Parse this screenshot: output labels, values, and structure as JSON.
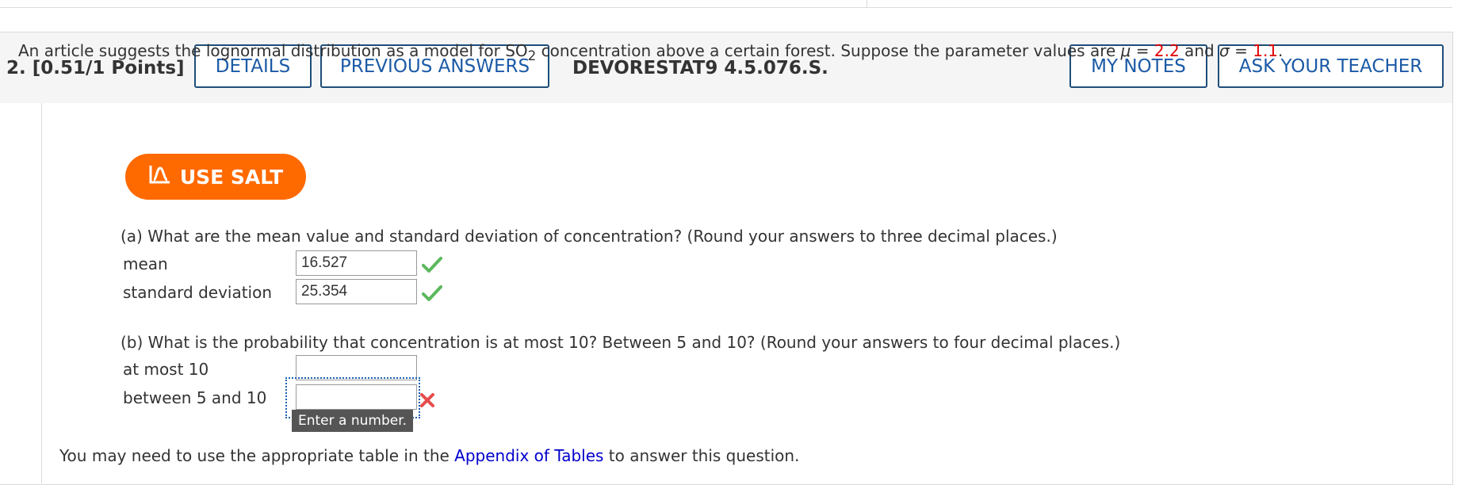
{
  "header": {
    "question_number": "2. [0.51/1 Points]",
    "details_label": "DETAILS",
    "previous_answers_label": "PREVIOUS ANSWERS",
    "problem_code": "DEVORESTAT9 4.5.076.S.",
    "my_notes_label": "MY NOTES",
    "ask_teacher_label": "ASK YOUR TEACHER"
  },
  "intro": {
    "text_before": "An article suggests the lognormal distribution as a model for SO",
    "subscript": "2",
    "text_middle": " concentration above a certain forest. Suppose the parameter values are ",
    "mu_symbol": "μ",
    "equals1": " = ",
    "mu_value": "2.2",
    "and_text": " and ",
    "sigma_symbol": "σ",
    "equals2": " = ",
    "sigma_value": "1.1",
    "period": "."
  },
  "salt_button": {
    "label": "USE SALT",
    "color": "#ff6a00"
  },
  "part_a": {
    "question": "(a) What are the mean value and standard deviation of concentration? (Round your answers to three decimal places.)",
    "mean_label": "mean",
    "mean_value": "16.527",
    "sd_label": "standard deviation",
    "sd_value": "25.354",
    "status_icon": "check-icon"
  },
  "part_b": {
    "question": "(b) What is the probability that concentration is at most 10? Between 5 and 10? (Round your answers to four decimal places.)",
    "at_most_label": "at most 10",
    "at_most_value": "",
    "between_label": "between 5 and 10",
    "between_value": "",
    "status_icon": "x-icon",
    "tooltip": "Enter a number."
  },
  "footer": {
    "text_before": "You may need to use the appropriate table in the ",
    "link_text": "Appendix of Tables",
    "text_after": " to answer this question."
  },
  "colors": {
    "button_border": "#1f4e79",
    "button_text": "#1b5aa6",
    "param_red": "#e00000",
    "correct_green": "#5cb85c",
    "wrong_red": "#e74c4c",
    "link_blue": "#0000cc"
  }
}
